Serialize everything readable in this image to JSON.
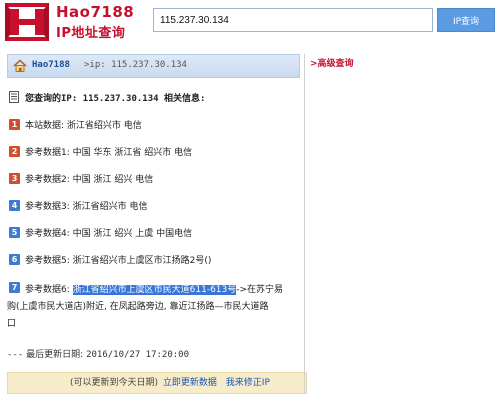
{
  "brand": {
    "name": "Hao7188",
    "subtitle": "IP地址查询",
    "mark_letter": "H"
  },
  "search": {
    "value": "115.237.30.134",
    "button_label": "IP查询"
  },
  "breadcrumb": {
    "home_link": "Hao7188",
    "current": ">ip: 115.237.30.134"
  },
  "side": {
    "advanced_link": ">高级查询"
  },
  "result": {
    "title": "您查询的IP: 115.237.30.134 相关信息:",
    "items": [
      {
        "num": "1",
        "label": "本站数据:",
        "value": "浙江省绍兴市 电信"
      },
      {
        "num": "2",
        "label": "参考数据1:",
        "value": "中国 华东 浙江省 绍兴市 电信"
      },
      {
        "num": "3",
        "label": "参考数据2:",
        "value": "中国 浙江 绍兴 电信"
      },
      {
        "num": "4",
        "label": "参考数据3:",
        "value": "浙江省绍兴市 电信"
      },
      {
        "num": "5",
        "label": "参考数据4:",
        "value": "中国 浙江 绍兴 上虞 中国电信"
      },
      {
        "num": "6",
        "label": "参考数据5:",
        "value": "浙江省绍兴市上虞区市江扬路2号()"
      },
      {
        "num": "7",
        "label": "参考数据6:",
        "highlighted": "浙江省绍兴市上虞区市民大道611-613号",
        "rest_line1": "->在苏宁易",
        "rest_line2": "购(上虞市民大道店)附近, 在凤起路旁边, 靠近江扬路—市民大道路",
        "rest_line3": "口"
      }
    ],
    "updated_prefix": "---",
    "updated_label": "最后更新日期:",
    "updated_value": "2016/10/27 17:20:00"
  },
  "footer": {
    "note": "(可以更新到今天日期)",
    "update_link": "立即更新数据",
    "fix_link": "我来修正IP"
  },
  "colors": {
    "brand_red": "#c8102e",
    "button_blue": "#5a9be2",
    "highlight_blue": "#3875d7",
    "footer_bg": "#f6ecc9"
  }
}
